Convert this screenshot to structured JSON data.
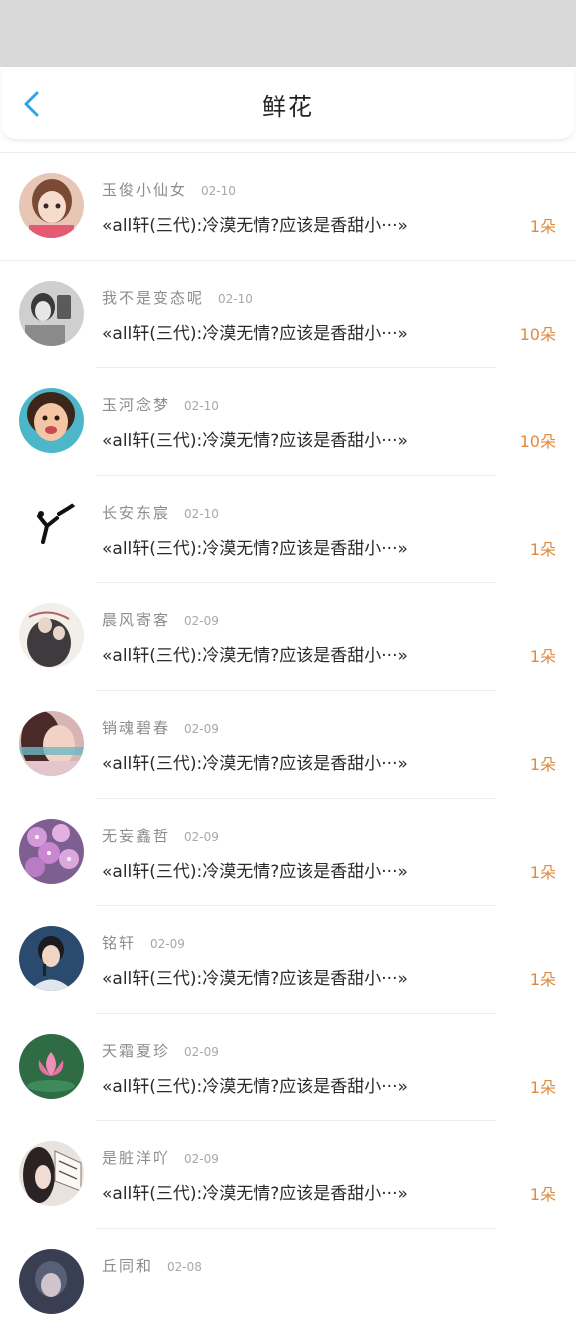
{
  "header": {
    "title": "鲜花"
  },
  "colors": {
    "accent": "#2fa4e7",
    "count": "#e08a3c"
  },
  "items": [
    {
      "name": "玉俊小仙女",
      "date": "02-10",
      "content": "«all轩(三代):冷漠无情?应该是香甜小···»",
      "count": "1朵",
      "avatar": "anime-girl-avatar"
    },
    {
      "name": "我不是变态呢",
      "date": "02-10",
      "content": "«all轩(三代):冷漠无情?应该是香甜小···»",
      "count": "10朵",
      "avatar": "bw-photo-avatar"
    },
    {
      "name": "玉河念梦",
      "date": "02-10",
      "content": "«all轩(三代):冷漠无情?应该是香甜小···»",
      "count": "10朵",
      "avatar": "child-photo-avatar"
    },
    {
      "name": "长安东宸",
      "date": "02-10",
      "content": "«all轩(三代):冷漠无情?应该是香甜小···»",
      "count": "1朵",
      "avatar": "calligraphy-avatar"
    },
    {
      "name": "晨风寄客",
      "date": "02-09",
      "content": "«all轩(三代):冷漠无情?应该是香甜小···»",
      "count": "1朵",
      "avatar": "ancient-art-avatar"
    },
    {
      "name": "销魂碧春",
      "date": "02-09",
      "content": "«all轩(三代):冷漠无情?应该是香甜小···»",
      "count": "1朵",
      "avatar": "portrait-avatar"
    },
    {
      "name": "无妄鑫哲",
      "date": "02-09",
      "content": "«all轩(三代):冷漠无情?应该是香甜小···»",
      "count": "1朵",
      "avatar": "flowers-avatar"
    },
    {
      "name": "铭轩",
      "date": "02-09",
      "content": "«all轩(三代):冷漠无情?应该是香甜小···»",
      "count": "1朵",
      "avatar": "singer-avatar"
    },
    {
      "name": "天霜夏珍",
      "date": "02-09",
      "content": "«all轩(三代):冷漠无情?应该是香甜小···»",
      "count": "1朵",
      "avatar": "lotus-avatar"
    },
    {
      "name": "是脏洋吖",
      "date": "02-09",
      "content": "«all轩(三代):冷漠无情?应该是香甜小···»",
      "count": "1朵",
      "avatar": "fan-avatar"
    },
    {
      "name": "丘同和",
      "date": "02-08",
      "content": "",
      "count": "",
      "avatar": "dark-avatar"
    }
  ]
}
